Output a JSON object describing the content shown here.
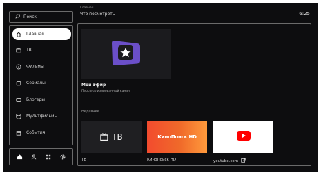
{
  "sidebar": {
    "search_label": "Поиск",
    "items": [
      {
        "label": "Главная",
        "icon": "home-icon"
      },
      {
        "label": "ТВ",
        "icon": "tv-icon"
      },
      {
        "label": "Фильмы",
        "icon": "film-icon"
      },
      {
        "label": "Сериалы",
        "icon": "series-icon"
      },
      {
        "label": "Блогеры",
        "icon": "bloggers-icon"
      },
      {
        "label": "Мультфильмы",
        "icon": "cartoon-icon"
      },
      {
        "label": "События",
        "icon": "events-icon"
      }
    ],
    "bottom_icons": [
      "home-icon",
      "profile-icon",
      "apps-icon",
      "settings-icon"
    ]
  },
  "header": {
    "breadcrumb": "Главная",
    "title": "Что посмотреть",
    "clock": "6:25"
  },
  "hero": {
    "title": "Мой Эфир",
    "subtitle": "Персонализированный канал",
    "accent_color": "#6b4fc9"
  },
  "recent": {
    "title": "Недавнее",
    "tiles": [
      {
        "label": "ТВ",
        "logo_text": "ТВ"
      },
      {
        "label": "КиноПоиск HD",
        "logo_text": "КиноПоиск HD"
      },
      {
        "label": "youtube.com",
        "logo_text": ""
      }
    ]
  }
}
